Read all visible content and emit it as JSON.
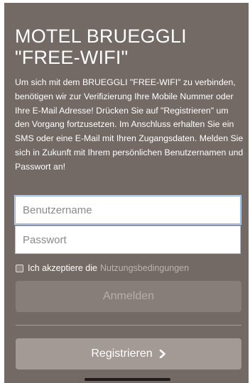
{
  "header": {
    "title_line1": "MOTEL BRUEGGLI",
    "title_line2": "\"FREE-WIFI\""
  },
  "intro": {
    "text": "Um sich mit dem BRUEGGLI \"FREE-WIFI\" zu verbinden, benötigen wir zur Verifizierung Ihre Mobile Nummer oder Ihre E-Mail Adresse! Drücken Sie auf \"Registrieren\" um den Vorgang fortzusetzen. Im Anschluss erhalten Sie ein SMS oder eine E-Mail mit Ihren Zugangsdaten. Melden Sie sich in Zukunft mit Ihrem persönlichen Benutzernamen und Passwort an!"
  },
  "form": {
    "username": {
      "placeholder": "Benutzername",
      "value": ""
    },
    "password": {
      "placeholder": "Passwort",
      "value": ""
    },
    "terms": {
      "label": "Ich akzeptiere die",
      "link": "Nutzungsbedingungen",
      "checked": false
    },
    "login_label": "Anmelden",
    "register_label": "Registrieren"
  },
  "icons": {
    "register_chevron": "chevron-right-icon"
  },
  "colors": {
    "background": "#736965",
    "login_button": "#877e7a",
    "register_button": "#a39995",
    "link_text": "#bcb2ae"
  }
}
